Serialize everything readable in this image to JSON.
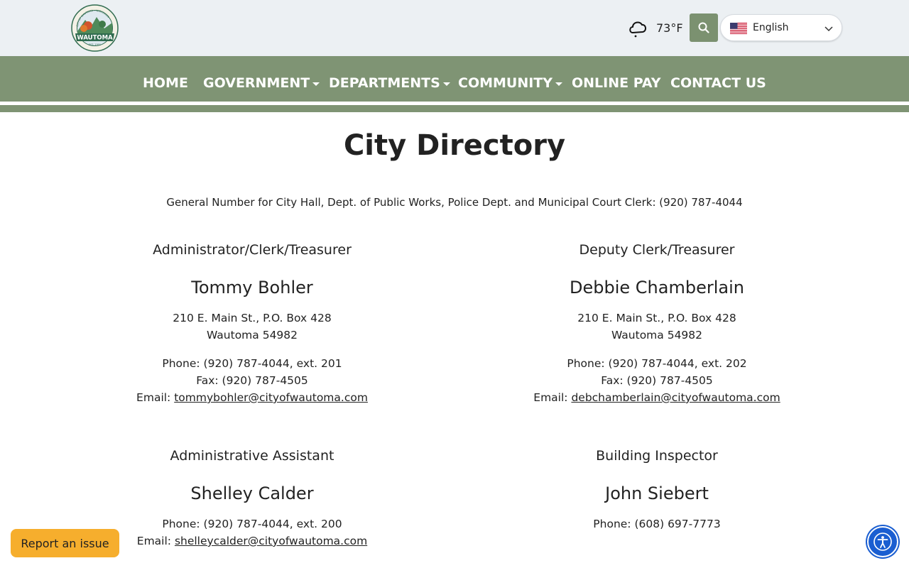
{
  "header": {
    "logo_text": "WAUTOMA",
    "logo_sub": "EST. 1901",
    "logo_arc": "CITY OF WAUTOMA • WISCONSIN •",
    "weather_icon": "cloud-drizzle-icon",
    "temperature": "73°F",
    "search_icon": "search-icon",
    "language": {
      "selected": "English",
      "flag": "us-flag-icon"
    }
  },
  "nav": {
    "items": [
      {
        "label": "HOME",
        "has_dropdown": false
      },
      {
        "label": "GOVERNMENT",
        "has_dropdown": true
      },
      {
        "label": "DEPARTMENTS",
        "has_dropdown": true
      },
      {
        "label": "COMMUNITY",
        "has_dropdown": true
      },
      {
        "label": "ONLINE PAY",
        "has_dropdown": false
      },
      {
        "label": "CONTACT US",
        "has_dropdown": false
      }
    ]
  },
  "main": {
    "title": "City Directory",
    "general_number": "General Number for City Hall, Dept. of Public Works, Police Dept. and Municipal Court Clerk: (920) 787-4044",
    "contacts": [
      {
        "role": "Administrator/Clerk/Treasurer",
        "name": "Tommy Bohler",
        "address_line1": "210 E. Main St., P.O. Box 428",
        "address_line2": "Wautoma 54982",
        "phone": "Phone: (920) 787-4044, ext. 201",
        "fax": "Fax: (920) 787-4505",
        "email_label": "Email: ",
        "email": "tommybohler@cityofwautoma.com"
      },
      {
        "role": "Deputy Clerk/Treasurer",
        "name": "Debbie Chamberlain",
        "address_line1": "210 E. Main St., P.O. Box 428",
        "address_line2": "Wautoma 54982",
        "phone": "Phone: (920) 787-4044, ext. 202",
        "fax": "Fax: (920) 787-4505",
        "email_label": "Email: ",
        "email": "debchamberlain@cityofwautoma.com"
      },
      {
        "role": "Administrative Assistant",
        "name": "Shelley Calder",
        "phone": "Phone: (920) 787-4044, ext. 200",
        "email_label": "Email: ",
        "email": "shelleycalder@cityofwautoma.com"
      },
      {
        "role": "Building Inspector",
        "name": "John Siebert",
        "phone": "Phone: (608) 697-7773"
      }
    ]
  },
  "footer": {
    "report_label": "Report an issue",
    "accessibility_icon": "accessibility-icon"
  },
  "colors": {
    "topbar": "#ecf0f3",
    "nav": "#7f9474",
    "search_button": "#7b9170",
    "report_button": "#f6ae2d",
    "accessibility": "#1a5ed1"
  }
}
